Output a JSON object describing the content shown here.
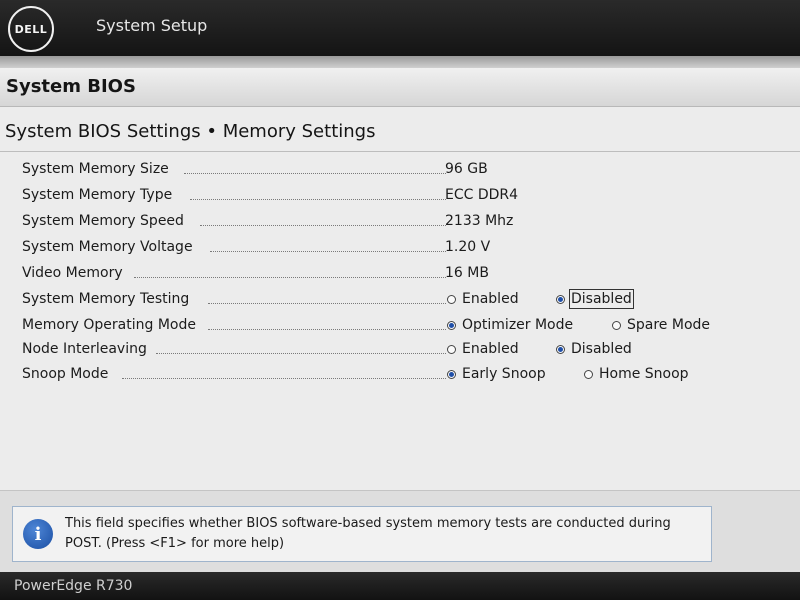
{
  "header": {
    "logo_text": "DELL",
    "app_title": "System Setup"
  },
  "section": {
    "title": "System BIOS"
  },
  "page": {
    "heading": "System BIOS Settings • Memory Settings"
  },
  "settings": [
    {
      "label": "System Memory Size",
      "value": "96 GB"
    },
    {
      "label": "System Memory Type",
      "value": "ECC DDR4"
    },
    {
      "label": "System Memory Speed",
      "value": "2133 Mhz"
    },
    {
      "label": "System Memory Voltage",
      "value": "1.20 V"
    },
    {
      "label": "Video Memory",
      "value": "16 MB"
    },
    {
      "label": "System Memory Testing",
      "options": [
        {
          "label": "Enabled",
          "selected": false
        },
        {
          "label": "Disabled",
          "selected": true
        }
      ]
    },
    {
      "label": "Memory Operating Mode",
      "options": [
        {
          "label": "Optimizer Mode",
          "selected": true
        },
        {
          "label": "Spare Mode",
          "selected": false
        }
      ]
    },
    {
      "label": "Node Interleaving",
      "options": [
        {
          "label": "Enabled",
          "selected": false
        },
        {
          "label": "Disabled",
          "selected": true
        }
      ]
    },
    {
      "label": "Snoop Mode",
      "options": [
        {
          "label": "Early Snoop",
          "selected": true
        },
        {
          "label": "Home Snoop",
          "selected": false
        }
      ]
    }
  ],
  "help": {
    "icon": "info-icon",
    "text": "This field specifies whether BIOS software-based system memory tests are conducted during POST. (Press <F1> for more help)"
  },
  "footer": {
    "model": "PowerEdge R730"
  },
  "colors": {
    "accent": "#1f4fa8",
    "header_bg": "#1c1c1c"
  }
}
